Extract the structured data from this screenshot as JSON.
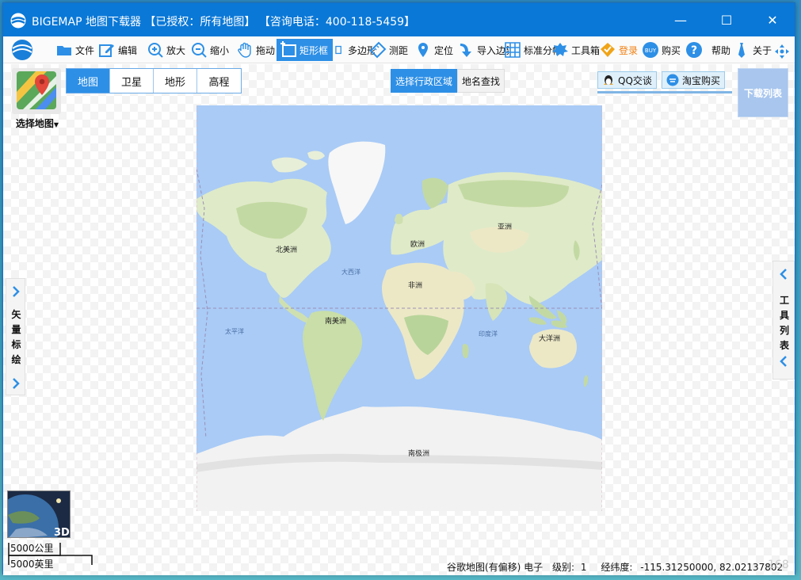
{
  "window": {
    "title": "BIGEMAP 地图下载器 【已授权：所有地图】 【咨询电话：400-118-5459】",
    "minimize": "—",
    "maximize": "☐",
    "close": "✕"
  },
  "toolbar": {
    "items": [
      {
        "label": "文件",
        "icon": "folder-icon"
      },
      {
        "label": "编辑",
        "icon": "edit-icon"
      },
      {
        "label": "放大",
        "icon": "zoom-in-icon"
      },
      {
        "label": "缩小",
        "icon": "zoom-out-icon"
      },
      {
        "label": "拖动",
        "icon": "hand-icon"
      },
      {
        "label": "矩形框",
        "icon": "rectangle-icon"
      },
      {
        "label": "多边形",
        "icon": "polygon-icon"
      },
      {
        "label": "测距",
        "icon": "ruler-icon"
      },
      {
        "label": "定位",
        "icon": "location-pin-icon"
      },
      {
        "label": "导入边界",
        "icon": "import-arrow-icon"
      },
      {
        "label": "标准分幅",
        "icon": "grid-icon"
      },
      {
        "label": "工具箱",
        "icon": "toolbox-icon"
      },
      {
        "label": "登录",
        "icon": "login-icon"
      },
      {
        "label": "购买",
        "icon": "buy-icon"
      },
      {
        "label": "帮助",
        "icon": "help-icon"
      },
      {
        "label": "关于",
        "icon": "tie-icon"
      }
    ]
  },
  "choose_map": {
    "label": "选择地图"
  },
  "map_types": [
    "地图",
    "卫星",
    "地形",
    "高程"
  ],
  "search_tabs": [
    "选择行政区域",
    "地名查找"
  ],
  "contact": {
    "qq": "QQ交谈",
    "taobao": "淘宝购买"
  },
  "download_list": "下载列表",
  "map": {
    "labels": {
      "north_america": "北美洲",
      "south_america": "南美洲",
      "europe": "欧洲",
      "asia": "亚洲",
      "africa": "非洲",
      "oceania": "大洋洲",
      "antarctica": "南极洲",
      "atlantic": "大西洋",
      "pacific": "太平洋",
      "indian": "印度洋"
    },
    "colors": {
      "ocean": "#a9cbf6",
      "land": "#dfeac8",
      "forest": "#b8d49a",
      "ice": "#f2f2f2"
    }
  },
  "side_left": {
    "label": "矢量标绘"
  },
  "side_right": {
    "label": "工具列表"
  },
  "globe3d": {
    "label": "3D"
  },
  "scale": {
    "metric": "5000公里",
    "imperial": "5000英里"
  },
  "status": {
    "source": "谷歌地图(有偏移) 电子",
    "level_label": "级别:",
    "level": "1",
    "coord_label": "经纬度:",
    "coords": "-115.31250000, 82.02137802"
  },
  "watermark": "168"
}
